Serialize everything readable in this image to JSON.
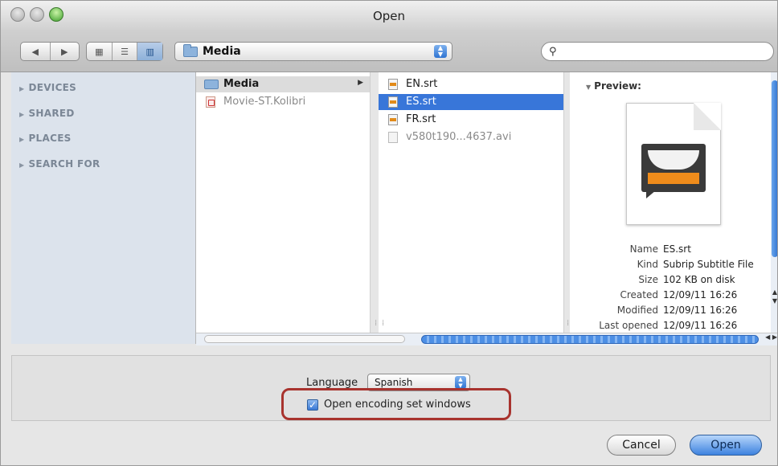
{
  "window": {
    "title": "Open"
  },
  "toolbar": {
    "nav_back": "◀",
    "nav_forward": "▶",
    "view_icons": "▦",
    "view_list": "☰",
    "view_columns": "▥",
    "location": "Media",
    "search_icon": "🔍",
    "search_value": ""
  },
  "sidebar": {
    "items": [
      {
        "label": "DEVICES"
      },
      {
        "label": "SHARED"
      },
      {
        "label": "PLACES"
      },
      {
        "label": "SEARCH FOR"
      }
    ]
  },
  "column1": {
    "items": [
      {
        "label": "Media",
        "icon": "folder-icon"
      },
      {
        "label": "Movie-ST.Kolibri",
        "icon": "document-icon"
      }
    ]
  },
  "column2": {
    "items": [
      {
        "label": "EN.srt",
        "icon": "subtitle-file-icon"
      },
      {
        "label": "ES.srt",
        "icon": "subtitle-file-icon"
      },
      {
        "label": "FR.srt",
        "icon": "subtitle-file-icon"
      },
      {
        "label": "v580t190...4637.avi",
        "icon": "video-file-icon"
      }
    ]
  },
  "preview": {
    "label": "Preview:",
    "info": [
      {
        "key": "Name",
        "value": "ES.srt"
      },
      {
        "key": "Kind",
        "value": "Subrip Subtitle File"
      },
      {
        "key": "Size",
        "value": "102 KB on disk"
      },
      {
        "key": "Created",
        "value": "12/09/11 16:26"
      },
      {
        "key": "Modified",
        "value": "12/09/11 16:26"
      },
      {
        "key": "Last opened",
        "value": "12/09/11 16:26"
      }
    ]
  },
  "options": {
    "language_label": "Language",
    "language_value": "Spanish",
    "checkbox_label": "Open encoding set windows",
    "checkbox_checked": true
  },
  "buttons": {
    "cancel": "Cancel",
    "open": "Open"
  },
  "colors": {
    "selection": "#3876d9",
    "highlight": "#a8332e",
    "accent": "#3d82df"
  }
}
